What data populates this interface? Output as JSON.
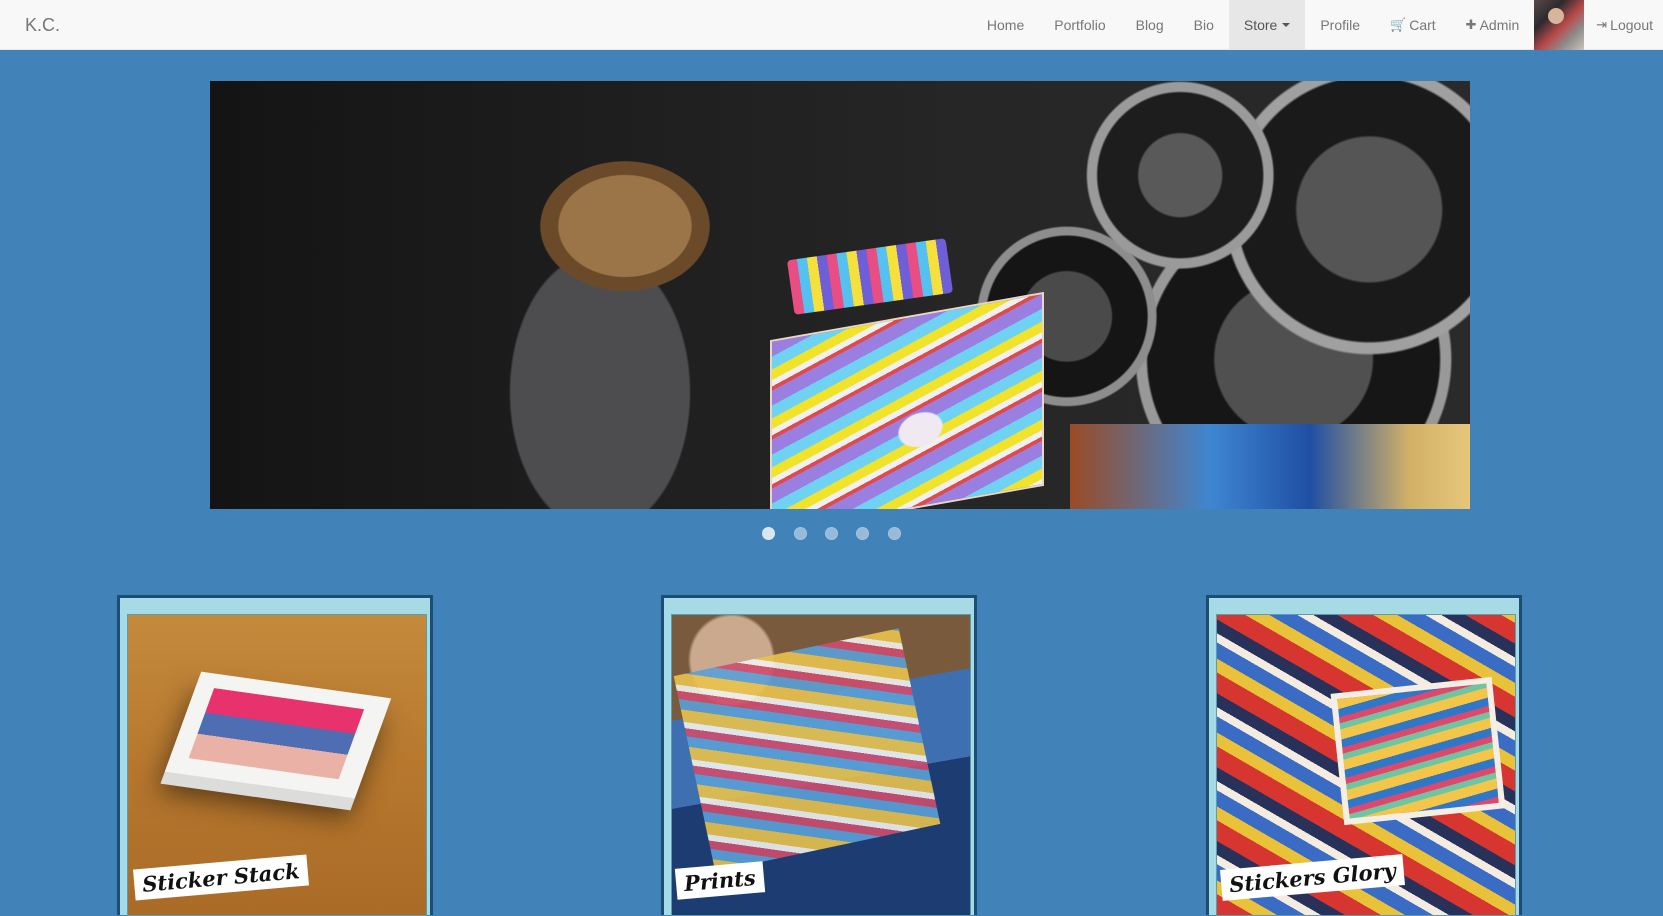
{
  "navbar": {
    "brand": "K.C.",
    "items": [
      {
        "label": "Home"
      },
      {
        "label": "Portfolio"
      },
      {
        "label": "Blog"
      },
      {
        "label": "Bio"
      },
      {
        "label": "Store",
        "active": true,
        "dropdown": true
      },
      {
        "label": "Profile"
      },
      {
        "label": "Cart",
        "icon": "cart-icon"
      },
      {
        "label": "Admin",
        "icon": "puzzle-icon"
      },
      {
        "label": "Logout",
        "icon": "logout-icon"
      }
    ]
  },
  "carousel": {
    "slide_count": 5,
    "active_index": 0
  },
  "cards": [
    {
      "label": "Sticker Stack"
    },
    {
      "label": "Prints"
    },
    {
      "label": "Stickers Glory"
    }
  ],
  "colors": {
    "page_background": "#4182b8",
    "navbar_background": "#f8f8f8",
    "card_background": "#a6dbe6",
    "card_border": "#1c4d73"
  }
}
